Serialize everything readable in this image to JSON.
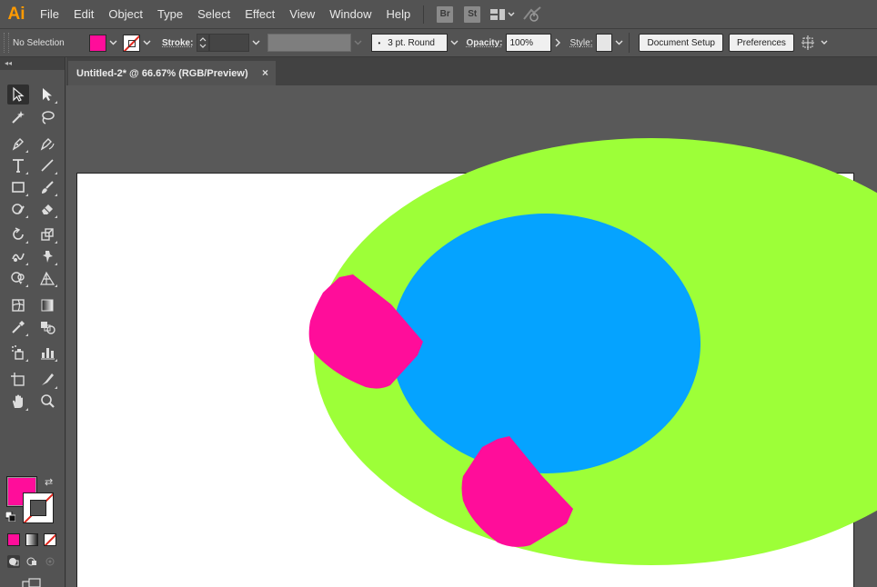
{
  "app": {
    "logo": "Ai"
  },
  "menu": {
    "items": [
      "File",
      "Edit",
      "Object",
      "Type",
      "Select",
      "Effect",
      "View",
      "Window",
      "Help"
    ],
    "bridge": "Br",
    "stock": "St",
    "workspace_icon": "arrange-documents-icon",
    "gpu_icon": "gpu-performance-icon"
  },
  "control_bar": {
    "selection": "No Selection",
    "stroke_label": "Stroke:",
    "brush": "3 pt. Round",
    "opacity_label": "Opacity:",
    "opacity_value": "100%",
    "style_label": "Style:",
    "document_setup": "Document Setup",
    "preferences": "Preferences"
  },
  "document": {
    "tab_title": "Untitled-2* @ 66.67% (RGB/Preview)",
    "close_glyph": "×"
  },
  "toolbar": {
    "collapse_glyph": "◂◂",
    "swap_glyph": "⇄"
  },
  "colors": {
    "fill": "#ff0d9a",
    "stroke": "none",
    "green_ellipse": "#9dff38",
    "blue_ellipse": "#05a3ff",
    "pink_shape": "#ff0d9a",
    "canvas_bg": "#595959",
    "artboard": "#ffffff"
  }
}
